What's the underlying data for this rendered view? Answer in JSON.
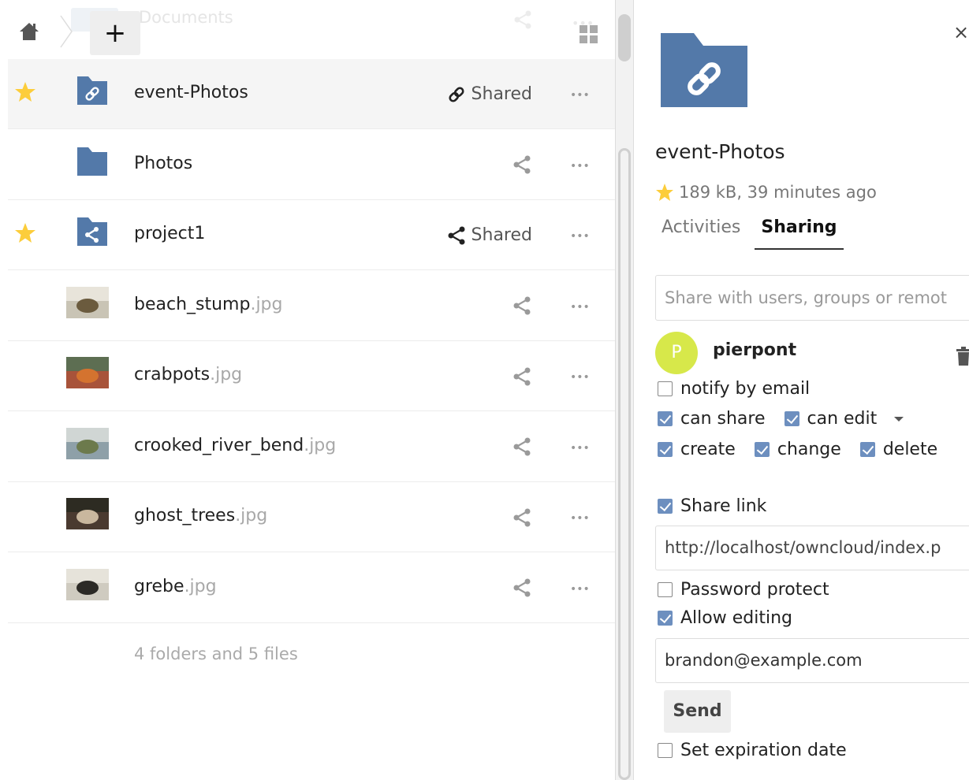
{
  "breadcrumb": {
    "current": "Documents",
    "new_label": "+"
  },
  "files": [
    {
      "name": "event-Photos",
      "ext": "",
      "starred": true,
      "type": "link-folder",
      "share_label": "Shared",
      "share_kind": "link",
      "selected": true
    },
    {
      "name": "Photos",
      "ext": "",
      "starred": false,
      "type": "folder",
      "share_label": "",
      "share_kind": "none",
      "selected": false
    },
    {
      "name": "project1",
      "ext": "",
      "starred": true,
      "type": "shared-folder",
      "share_label": "Shared",
      "share_kind": "share",
      "selected": false
    },
    {
      "name": "beach_stump",
      "ext": ".jpg",
      "starred": false,
      "type": "image",
      "share_label": "",
      "share_kind": "none",
      "selected": false
    },
    {
      "name": "crabpots",
      "ext": ".jpg",
      "starred": false,
      "type": "image",
      "share_label": "",
      "share_kind": "none",
      "selected": false
    },
    {
      "name": "crooked_river_bend",
      "ext": ".jpg",
      "starred": false,
      "type": "image",
      "share_label": "",
      "share_kind": "none",
      "selected": false
    },
    {
      "name": "ghost_trees",
      "ext": ".jpg",
      "starred": false,
      "type": "image",
      "share_label": "",
      "share_kind": "none",
      "selected": false
    },
    {
      "name": "grebe",
      "ext": ".jpg",
      "starred": false,
      "type": "image",
      "share_label": "",
      "share_kind": "none",
      "selected": false
    }
  ],
  "summary": "4 folders and 5 files",
  "more_label": "•••",
  "details": {
    "title": "event-Photos",
    "meta": "189 kB, 39 minutes ago",
    "tabs": [
      {
        "label": "Activities"
      },
      {
        "label": "Sharing"
      }
    ],
    "share_placeholder": "Share with users, groups or remot",
    "share_user": {
      "initial": "P",
      "name": "pierpont"
    },
    "notify_label": "notify by email",
    "can_share_label": "can share",
    "can_edit_label": "can edit",
    "create_label": "create",
    "change_label": "change",
    "delete_label": "delete",
    "share_link_label": "Share link",
    "link_url": "http://localhost/owncloud/index.p",
    "password_label": "Password protect",
    "allow_editing_label": "Allow editing",
    "email_value": "brandon@example.com",
    "send_label": "Send",
    "expiration_label": "Set expiration date",
    "close_label": "×"
  },
  "colors": {
    "folder": "#5379a9",
    "star": "#fccd3b",
    "check": "#6d8fbf",
    "avatar": "#d7e84a"
  }
}
